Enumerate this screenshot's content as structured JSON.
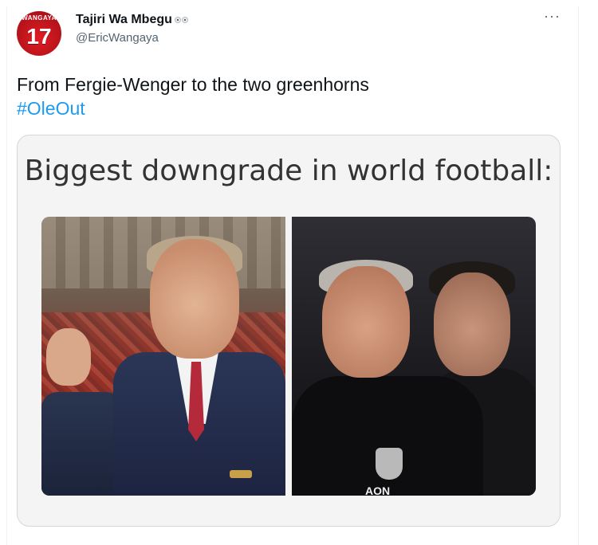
{
  "author": {
    "display_name": "Tajiri Wa Mbegu",
    "handle": "@EricWangaya",
    "avatar_text_top": "WANGAYA",
    "avatar_number": "17"
  },
  "tweet": {
    "text": "From Fergie-Wenger to the two greenhorns",
    "hashtag": "#OleOut"
  },
  "media": {
    "caption": "Biggest downgrade in world football:",
    "sponsor_text": "AON"
  },
  "icons": {
    "more": "more-options-icon",
    "emoji": "eyes-emoji-icon"
  },
  "colors": {
    "link": "#1d9bf0",
    "secondary_text": "#536471",
    "primary_text": "#0f1419"
  }
}
